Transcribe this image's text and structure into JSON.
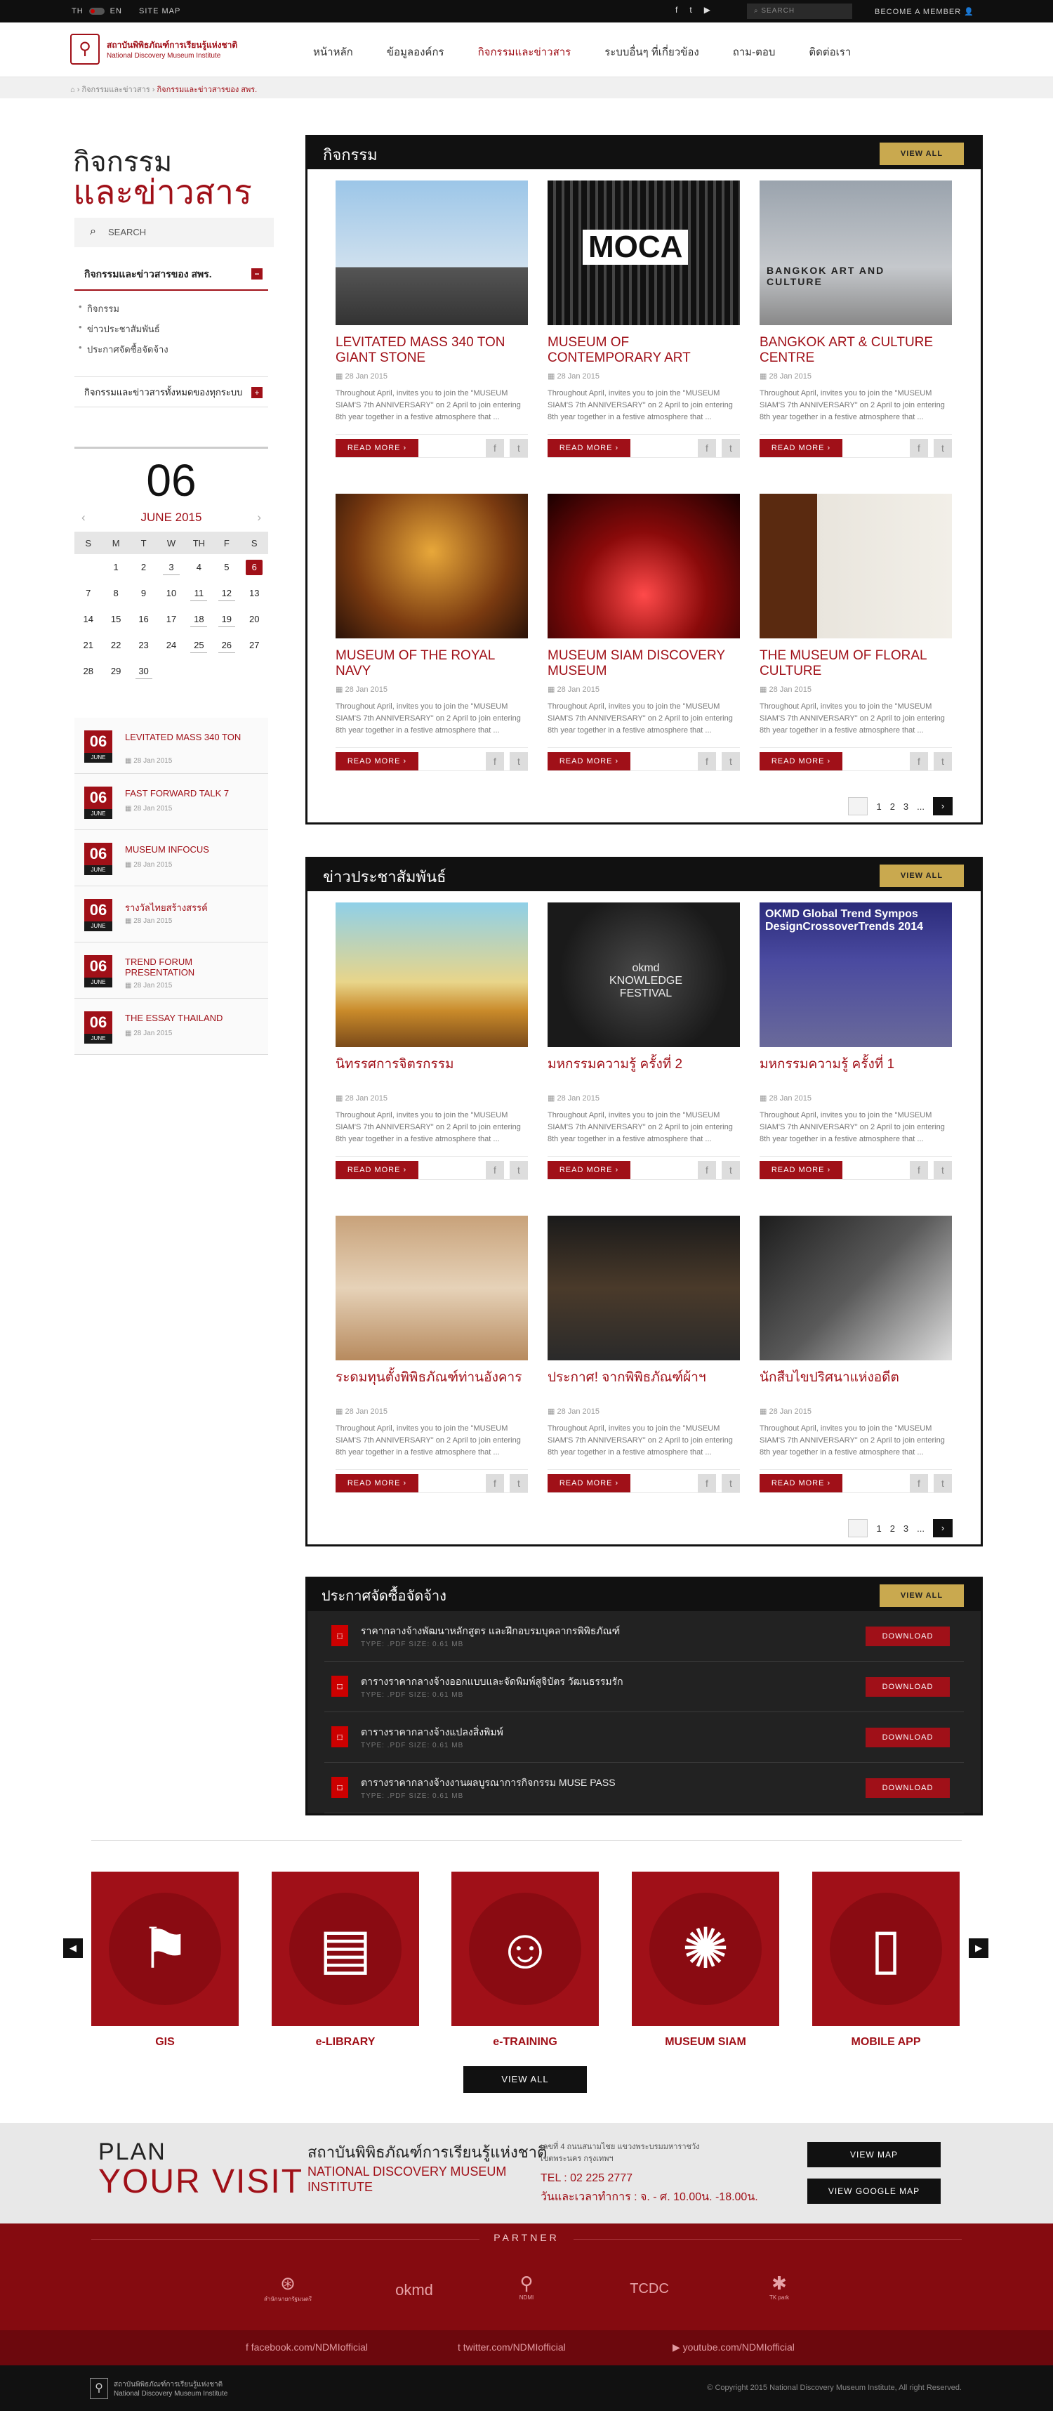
{
  "topbar": {
    "lang_th": "TH",
    "lang_en": "EN",
    "sitemap": "SITE MAP",
    "search_placeholder": "SEARCH",
    "member": "BECOME A MEMBER"
  },
  "logo": {
    "th": "สถาบันพิพิธภัณฑ์การเรียนรู้แห่งชาติ",
    "en": "National Discovery Museum Institute"
  },
  "nav": [
    "หน้าหลัก",
    "ข้อมูลองค์กร",
    "กิจกรรมและข่าวสาร",
    "ระบบอื่นๆ ที่เกี่ยวข้อง",
    "ถาม-ตอบ",
    "ติดต่อเรา"
  ],
  "breadcrumb": {
    "home": "⌂",
    "level1": "กิจกรรมและข่าวสาร",
    "current": "กิจกรรมและข่าวสารของ สพร."
  },
  "sidebar": {
    "title_line1": "กิจกรรม",
    "title_line2": "และข่าวสาร",
    "search_placeholder": "SEARCH",
    "section1": "กิจกรรมและข่าวสารของ สพร.",
    "section1_toggle": "−",
    "items": [
      "กิจกรรม",
      "ข่าวประชาสัมพันธ์",
      "ประกาศจัดซื้อจัดจ้าง"
    ],
    "section2": "กิจกรรมและข่าวสารทั้งหมดของทุกระบบ",
    "section2_toggle": "+"
  },
  "calendar": {
    "big_day": "06",
    "month": "JUNE 2015",
    "weekdays": [
      "S",
      "M",
      "T",
      "W",
      "TH",
      "F",
      "S"
    ]
  },
  "side_events": [
    {
      "day": "06",
      "mon": "JUNE",
      "title": "LEVITATED MASS 340 TON",
      "date": "28 Jan 2015"
    },
    {
      "day": "06",
      "mon": "JUNE",
      "title": "FAST FORWARD TALK 7",
      "date": "28 Jan 2015"
    },
    {
      "day": "06",
      "mon": "JUNE",
      "title": "MUSEUM INFOCUS",
      "date": "28 Jan 2015"
    },
    {
      "day": "06",
      "mon": "JUNE",
      "title": "รางวัลไทยสร้างสรรค์",
      "date": "28 Jan 2015"
    },
    {
      "day": "06",
      "mon": "JUNE",
      "title": "TREND FORUM PRESENTATION",
      "date": "28 Jan 2015"
    },
    {
      "day": "06",
      "mon": "JUNE",
      "title": "THE ESSAY THAILAND",
      "date": "28 Jan 2015"
    }
  ],
  "common": {
    "view_all": "VIEW ALL",
    "read_more": "READ MORE  ›",
    "excerpt": "Throughout April, invites you to join the \"MUSEUM SIAM'S 7th ANNIVERSARY\" on 2 April to join entering 8th year together in a festive atmosphere that ...",
    "date": "28 Jan 2015",
    "fb": "f",
    "tw": "t",
    "pages": [
      "1",
      "2",
      "3",
      "..."
    ]
  },
  "activities": {
    "title": "กิจกรรม",
    "cards": [
      {
        "title": "LEVITATED MASS 340 TON GIANT STONE"
      },
      {
        "title": "MUSEUM OF CONTEMPORARY ART",
        "img_text": "MOCA"
      },
      {
        "title": "BANGKOK ART & CULTURE CENTRE",
        "img_text": "BANGKOK ART AND CULTURE"
      },
      {
        "title": "MUSEUM OF THE ROYAL NAVY"
      },
      {
        "title": "MUSEUM SIAM DISCOVERY MUSEUM"
      },
      {
        "title": "THE MUSEUM OF FLORAL CULTURE"
      }
    ]
  },
  "news": {
    "title": "ข่าวประชาสัมพันธ์",
    "cards": [
      {
        "title": "นิทรรศการจิตรกรรม"
      },
      {
        "title": "มหกรรมความรู้ ครั้งที่ 2",
        "img_text": "okmd KNOWLEDGE FESTIVAL"
      },
      {
        "title": "มหกรรมความรู้ ครั้งที่ 1",
        "img_text": "OKMD Global Trend Sympos DesignCrossoverTrends 2014"
      },
      {
        "title": "ระดมทุนตั้งพิพิธภัณฑ์ท่านอังคาร"
      },
      {
        "title": "ประกาศ! จากพิพิธภัณฑ์ผ้าฯ"
      },
      {
        "title": "นักสืบไขปริศนาแห่งอดีต"
      }
    ]
  },
  "announcements": {
    "title": "ประกาศจัดซื้อจัดจ้าง",
    "download": "DOWNLOAD",
    "meta": "TYPE: .PDF     SIZE: 0.61 MB",
    "items": [
      "ราคากลางจ้างพัฒนาหลักสูตร และฝึกอบรมบุคลากรพิพิธภัณฑ์",
      "ตารางราคากลางจ้างออกแบบและจัดพิมพ์สูจิบัตร วัฒนธรรมรัก",
      "ตารางราคากลางจ้างแปลงสิ่งพิมพ์",
      "ตารางราคากลางจ้างงานผลบูรณาการกิจกรรม MUSE PASS"
    ]
  },
  "services": {
    "items": [
      "GIS",
      "e-LIBRARY",
      "e-TRAINING",
      "MUSEUM SIAM",
      "MOBILE APP"
    ],
    "view_all": "VIEW ALL",
    "prev": "◀",
    "next": "▶"
  },
  "plan": {
    "line1": "PLAN",
    "line2": "YOUR VISIT",
    "name_th": "สถาบันพิพิธภัณฑ์การเรียนรู้แห่งชาติ",
    "name_en": "NATIONAL DISCOVERY MUSEUM INSTITUTE",
    "address": "เลขที่ 4 ถนนสนามไชย แขวงพระบรมมหาราชวัง เขตพระนคร กรุงเทพฯ",
    "tel": "TEL : 02 225 2777",
    "hours": "วันและเวลาทำการ : จ. - ศ. 10.00น. -18.00น.",
    "view_map": "VIEW MAP",
    "view_google_map": "VIEW GOOGLE MAP"
  },
  "partner": {
    "title": "PARTNER",
    "logos": [
      "สำนักนายกรัฐมนตรี",
      "okmd",
      "NDMI",
      "TCDC",
      "TK park"
    ]
  },
  "social": {
    "facebook": "facebook.com/NDMIofficial",
    "twitter": "twitter.com/NDMIofficial",
    "youtube": "youtube.com/NDMIofficial"
  },
  "footer": {
    "logo_th": "สถาบันพิพิธภัณฑ์การเรียนรู้แห่งชาติ",
    "logo_en": "National Discovery Museum Institute",
    "copyright": "© Copyright 2015 National Discovery Museum Institute, All right Reserved."
  },
  "colors": {
    "brand": "#a01018",
    "gold": "#c9a94f",
    "dark": "#111111"
  }
}
